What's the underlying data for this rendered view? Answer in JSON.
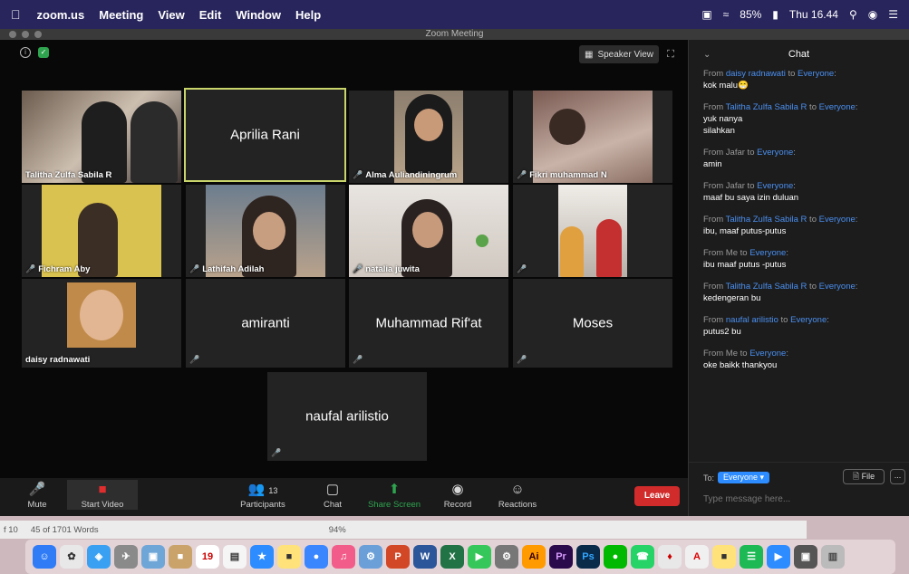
{
  "menubar": {
    "apple": "",
    "app": "zoom.us",
    "items": [
      "Meeting",
      "View",
      "Edit",
      "Window",
      "Help"
    ],
    "battery": "85%",
    "clock": "Thu 16.44"
  },
  "window": {
    "title": "Zoom Meeting"
  },
  "topbar": {
    "speaker_view": "Speaker View"
  },
  "participants": [
    {
      "name": "Talitha Zulfa Sabila R",
      "type": "video"
    },
    {
      "name": "Aprilia Rani",
      "type": "name"
    },
    {
      "name": "Alma Auliandiningrum",
      "type": "video"
    },
    {
      "name": "Fikri muhammad N",
      "type": "video"
    },
    {
      "name": "Fichram Aby",
      "type": "video"
    },
    {
      "name": "Lathifah Adilah",
      "type": "video"
    },
    {
      "name": "natalia juwita",
      "type": "video"
    },
    {
      "name": "",
      "type": "video"
    },
    {
      "name": "daisy radnawati",
      "type": "video"
    },
    {
      "name": "amiranti",
      "type": "name"
    },
    {
      "name": "Muhammad Rif'at",
      "type": "name"
    },
    {
      "name": "Moses",
      "type": "name"
    },
    {
      "name": "naufal arilistio",
      "type": "name"
    }
  ],
  "chat": {
    "title": "Chat",
    "messages": [
      {
        "prefix": "From ",
        "sender": "daisy radnawati",
        "to_word": " to ",
        "recipient": "Everyone",
        "suffix": ":",
        "text": "kok malu😁"
      },
      {
        "prefix": "From ",
        "sender": "Talitha Zulfa Sabila R",
        "to_word": " to ",
        "recipient": "Everyone",
        "suffix": ":",
        "text": "yuk nanya",
        "text2": "silahkan"
      },
      {
        "prefix": "From Jafar to ",
        "sender": "",
        "to_word": "",
        "recipient": "Everyone",
        "suffix": ":",
        "text": "amin"
      },
      {
        "prefix": "From Jafar to ",
        "sender": "",
        "to_word": "",
        "recipient": "Everyone",
        "suffix": ":",
        "text": "maaf bu saya izin duluan"
      },
      {
        "prefix": "From ",
        "sender": "Talitha Zulfa Sabila R",
        "to_word": " to ",
        "recipient": "Everyone",
        "suffix": ":",
        "text": "ibu, maaf putus-putus"
      },
      {
        "prefix": "From Me to ",
        "sender": "",
        "to_word": "",
        "recipient": "Everyone",
        "suffix": ":",
        "text": "ibu maaf putus -putus"
      },
      {
        "prefix": "From ",
        "sender": "Talitha Zulfa Sabila R",
        "to_word": " to ",
        "recipient": "Everyone",
        "suffix": ":",
        "text": "kedengeran bu"
      },
      {
        "prefix": "From ",
        "sender": "naufal arilistio",
        "to_word": " to ",
        "recipient": "Everyone",
        "suffix": ":",
        "text": "putus2 bu"
      },
      {
        "prefix": "From Me to ",
        "sender": "",
        "to_word": "",
        "recipient": "Everyone",
        "suffix": ":",
        "text": "oke baikk thankyou"
      }
    ],
    "to_label": "To:",
    "to_value": "Everyone",
    "file_label": "File",
    "more_label": "...",
    "placeholder": "Type message here..."
  },
  "toolbar": {
    "mute": "Mute",
    "start_video": "Start Video",
    "participants": "Participants",
    "participant_count": "13",
    "chat": "Chat",
    "share_screen": "Share Screen",
    "record": "Record",
    "reactions": "Reactions",
    "leave": "Leave"
  },
  "statusbar": {
    "page": "f 10",
    "words": "45 of 1701 Words",
    "zoom": "94%"
  },
  "colors": {
    "accent": "#2d8cff",
    "leave": "#d12b2b",
    "share": "#2ea44f",
    "mute_red": "#e02d2d"
  }
}
